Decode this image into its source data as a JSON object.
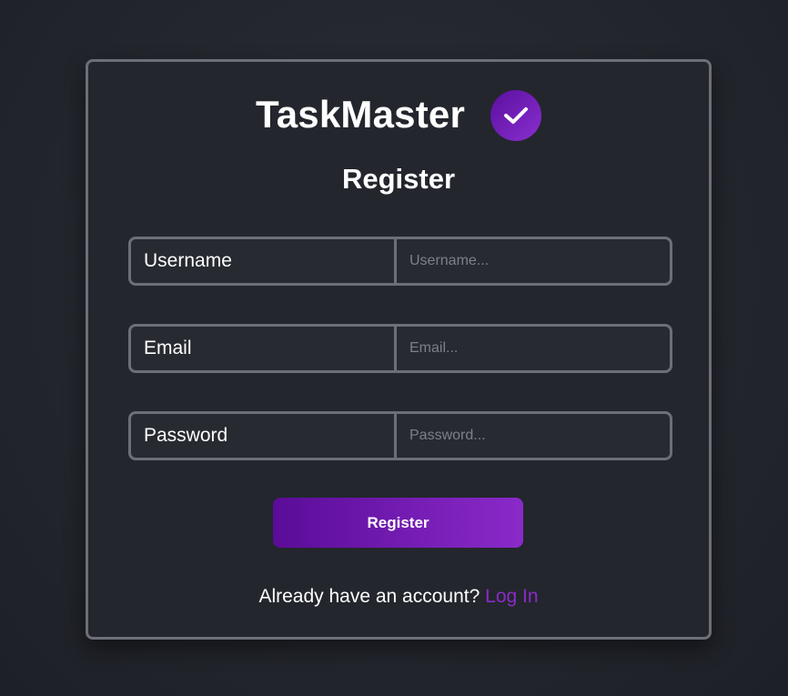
{
  "brand": {
    "title": "TaskMaster",
    "badge_icon": "check-icon",
    "badge_color_start": "#5b0f9e",
    "badge_color_end": "#8a2fd0"
  },
  "form": {
    "heading": "Register",
    "fields": [
      {
        "label": "Username",
        "placeholder": "Username...",
        "value": ""
      },
      {
        "label": "Email",
        "placeholder": "Email...",
        "value": ""
      },
      {
        "label": "Password",
        "placeholder": "Password...",
        "value": ""
      }
    ],
    "submit_label": "Register"
  },
  "footer": {
    "prompt": "Already have an account?",
    "link_label": "Log In"
  },
  "colors": {
    "accent": "#8a2ac9",
    "background": "#23262d",
    "border": "#6c6f78"
  }
}
